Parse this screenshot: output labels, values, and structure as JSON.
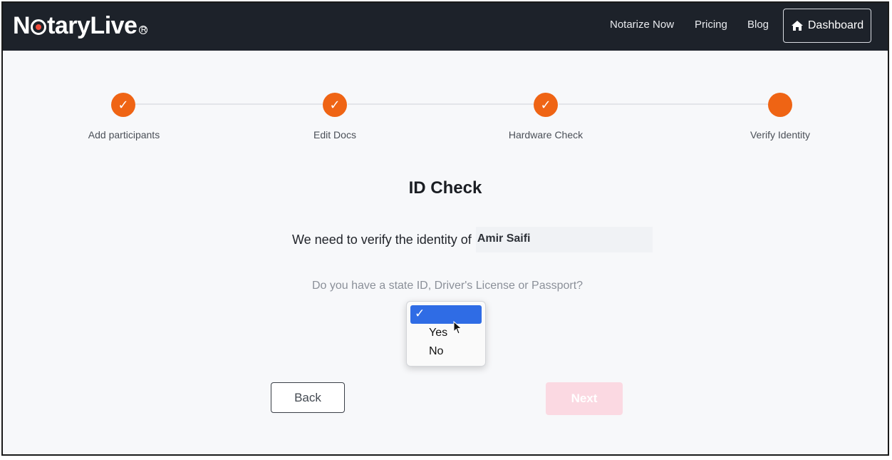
{
  "nav": {
    "logo_text_before": "N",
    "logo_text_after": "taryLive",
    "links": [
      "Notarize Now",
      "Pricing",
      "Blog"
    ],
    "dashboard_label": "Dashboard"
  },
  "stepper": {
    "steps": [
      {
        "label": "Add participants",
        "state": "complete",
        "mark": "✓"
      },
      {
        "label": "Edit Docs",
        "state": "complete",
        "mark": "✓"
      },
      {
        "label": "Hardware Check",
        "state": "complete",
        "mark": "✓"
      },
      {
        "label": "Verify Identity",
        "state": "current",
        "mark": ""
      }
    ],
    "accent_color": "#ef6414"
  },
  "main": {
    "title": "ID Check",
    "verify_prefix": "We need to verify the identity of",
    "participant_name": "Amir Saifi",
    "question": "Do you have a state ID, Driver's License or Passport?"
  },
  "id_select": {
    "options": [
      {
        "label": "",
        "selected": true,
        "check": "✓"
      },
      {
        "label": "Yes",
        "selected": false
      },
      {
        "label": "No",
        "selected": false
      }
    ]
  },
  "actions": {
    "back_label": "Back",
    "next_label": "Next"
  }
}
